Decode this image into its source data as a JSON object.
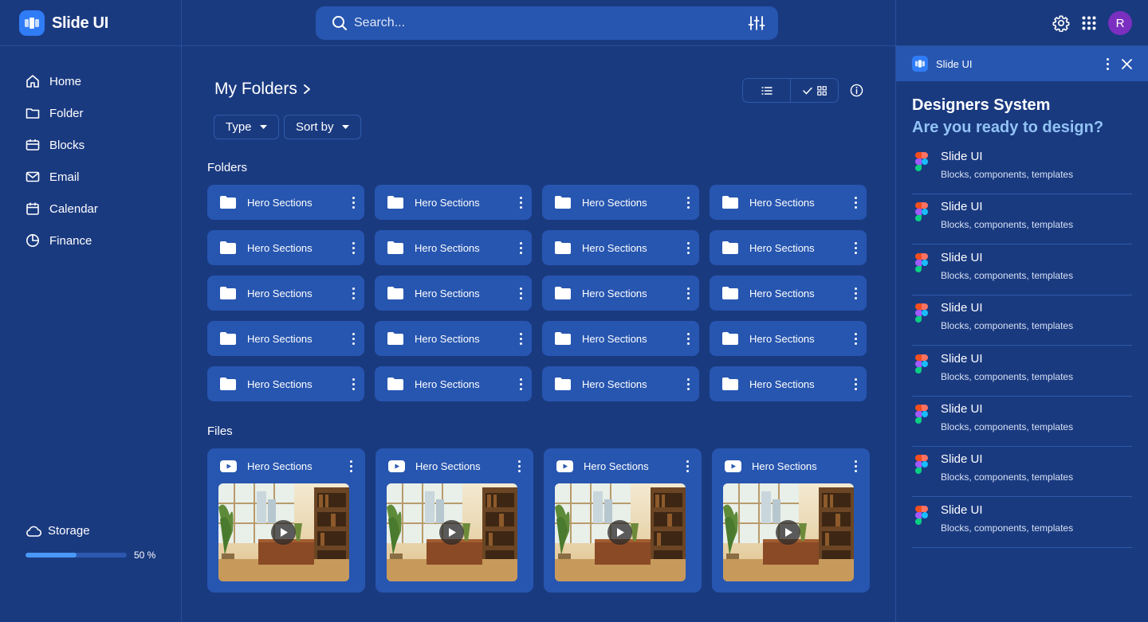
{
  "app": {
    "name": "Slide UI"
  },
  "search": {
    "placeholder": "Search..."
  },
  "header": {
    "avatar_initial": "R"
  },
  "sidebar": {
    "items": [
      {
        "label": "Home",
        "icon": "home-icon"
      },
      {
        "label": "Folder",
        "icon": "folder-icon"
      },
      {
        "label": "Blocks",
        "icon": "blocks-icon"
      },
      {
        "label": "Email",
        "icon": "email-icon"
      },
      {
        "label": "Calendar",
        "icon": "calendar-icon"
      },
      {
        "label": "Finance",
        "icon": "pie-chart-icon"
      }
    ],
    "storage": {
      "label": "Storage",
      "percent_text": "50 %",
      "percent": 50
    }
  },
  "main": {
    "title": "My Folders",
    "filters": {
      "type_label": "Type",
      "sort_label": "Sort by"
    },
    "folders_label": "Folders",
    "folders": [
      "Hero Sections",
      "Hero Sections",
      "Hero Sections",
      "Hero Sections",
      "Hero Sections",
      "Hero Sections",
      "Hero Sections",
      "Hero Sections",
      "Hero Sections",
      "Hero Sections",
      "Hero Sections",
      "Hero Sections",
      "Hero Sections",
      "Hero Sections",
      "Hero Sections",
      "Hero Sections",
      "Hero Sections",
      "Hero Sections",
      "Hero Sections",
      "Hero Sections"
    ],
    "files_label": "Files",
    "files": [
      "Hero Sections",
      "Hero Sections",
      "Hero Sections",
      "Hero Sections"
    ]
  },
  "panel": {
    "app_name": "Slide UI",
    "title": "Designers System",
    "subtitle": "Are you ready to design?",
    "items": [
      {
        "title": "Slide UI",
        "subtitle": "Blocks, components, templates"
      },
      {
        "title": "Slide UI",
        "subtitle": "Blocks, components, templates"
      },
      {
        "title": "Slide UI",
        "subtitle": "Blocks, components, templates"
      },
      {
        "title": "Slide UI",
        "subtitle": "Blocks, components, templates"
      },
      {
        "title": "Slide UI",
        "subtitle": "Blocks, components, templates"
      },
      {
        "title": "Slide UI",
        "subtitle": "Blocks, components, templates"
      },
      {
        "title": "Slide UI",
        "subtitle": "Blocks, components, templates"
      },
      {
        "title": "Slide UI",
        "subtitle": "Blocks, components, templates"
      }
    ]
  },
  "colors": {
    "background": "#1a3a80",
    "card": "#2756b0",
    "accent": "#2f7cf6",
    "subtitle": "#92c3f5",
    "avatar": "#7b2fc0"
  }
}
